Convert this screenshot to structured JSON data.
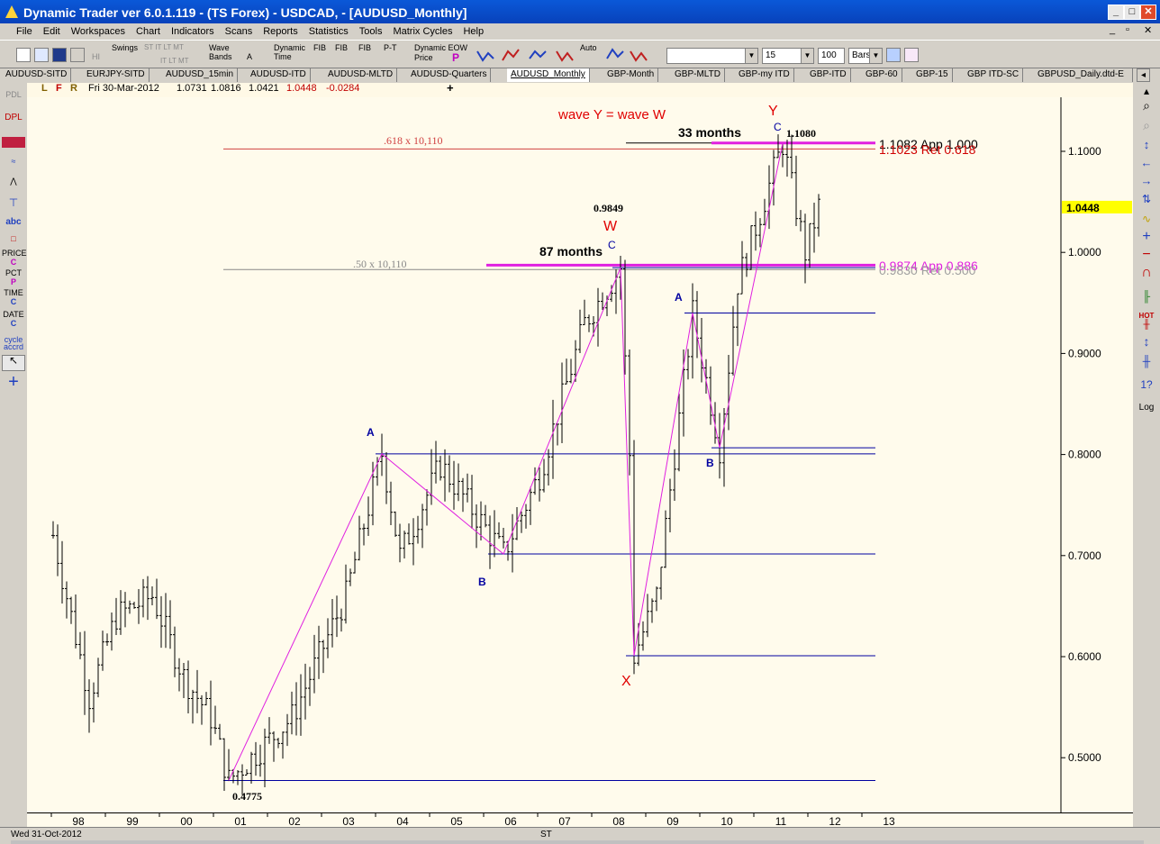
{
  "window": {
    "title": "Dynamic Trader ver 6.0.1.119 - (TS Forex) - USDCAD, - [AUDUSD_Monthly]",
    "controls": [
      "_",
      "□",
      "✕"
    ],
    "mdi_controls": [
      "_",
      "▫",
      "✕"
    ]
  },
  "menu": [
    "File",
    "Edit",
    "Workspaces",
    "Chart",
    "Indicators",
    "Scans",
    "Reports",
    "Statistics",
    "Tools",
    "Matrix Cycles",
    "Help"
  ],
  "toolbar": {
    "swings": "Swings",
    "swings_sub": "ST IT LT MT",
    "swings_sub2": "IT LT MT",
    "wave_bands": "Wave Bands",
    "wave_bands_a": "A",
    "dynamic_time": "Dynamic Time",
    "fib_t1": "FIB",
    "fib_t2": "FIB",
    "fib_t3": "FIB",
    "pt": "P-T",
    "dynamic_eow": "Dynamic EOW",
    "price": "Price",
    "p": "P",
    "auto": "Auto",
    "hi": "HI",
    "select1_value": "",
    "select2_value": "15",
    "count_value": "100",
    "bars_value": "Bars"
  },
  "tabs": [
    "AUDUSD-SITD",
    "EURJPY-SITD",
    "AUDUSD_15min",
    "AUDUSD-ITD",
    "AUDUSD-MLTD",
    "AUDUSD-Quarters",
    "AUDUSD_Monthly",
    "GBP-Month",
    "GBP-MLTD",
    "GBP-my ITD",
    "GBP-ITD",
    "GBP-60",
    "GBP-15",
    "GBP ITD-SC",
    "GBPUSD_Daily.dtd-E"
  ],
  "active_tab": "AUDUSD_Monthly",
  "infobar": {
    "l": "L",
    "f": "F",
    "r": "R",
    "date": "Fri 30-Mar-2012",
    "open": "1.0731",
    "high": "1.0816",
    "low": "1.0421",
    "close": "1.0448",
    "change": "-0.0284",
    "plus": "+"
  },
  "leftbar": {
    "pdl": "PDL",
    "dpl": "DPL",
    "abc": "abc",
    "price": "PRICE",
    "pct": "PCT",
    "time": "TIME",
    "date": "DATE",
    "cycle": "cycle",
    "accrd": "accrd",
    "c": "C",
    "p": "P"
  },
  "rightbar": {
    "hot": "HOT",
    "log": "Log",
    "q": "1?"
  },
  "status": {
    "date": "Wed 31-Oct-2012",
    "st": "ST"
  },
  "colors": {
    "magenta": "#e020e0",
    "blue": "#0000a0",
    "red": "#e00000",
    "price_tag": "#ffff00"
  },
  "chart_data": {
    "type": "ohlc-bar",
    "symbol": "AUDUSD",
    "timeframe": "Monthly",
    "x_tick_labels": [
      "98",
      "99",
      "00",
      "01",
      "02",
      "03",
      "04",
      "05",
      "06",
      "07",
      "08",
      "09",
      "10",
      "11",
      "12",
      "13"
    ],
    "y_tick_labels": [
      "1.1000",
      "1.0000",
      "0.9000",
      "0.8000",
      "0.7000",
      "0.6000",
      "0.5000"
    ],
    "ylim": [
      0.45,
      1.15
    ],
    "last_price_tag": "1.0448",
    "annotations": {
      "wave_y_eq_w": "wave Y = wave W",
      "fib_618": ".618 x 10,110",
      "fib_50": ".50 x 10,110",
      "months_33": "33 months",
      "months_87": "87 months",
      "high_1": "1.1080",
      "high_w": "0.9849",
      "low_0": "0.4775",
      "label_w": "W",
      "label_x": "X",
      "label_y": "Y",
      "label_c": "C",
      "label_a": "A",
      "label_b": "B",
      "app_1": "1.1082 App 1.000",
      "ret_618": "1.1023 Ret 0.618",
      "app_886": "0.9874 App 0.886",
      "ret_500": "0.9830 Ret 0.500"
    },
    "swings": [
      {
        "date": "2001-04",
        "price": 0.4775
      },
      {
        "date": "2004-02",
        "price": 0.8007
      },
      {
        "date": "2006-05",
        "price": 0.7016
      },
      {
        "date": "2008-07",
        "price": 0.9849
      },
      {
        "date": "2008-10",
        "price": 0.6009
      },
      {
        "date": "2009-11",
        "price": 0.94
      },
      {
        "date": "2010-05",
        "price": 0.8067
      },
      {
        "date": "2011-07",
        "price": 1.108
      }
    ]
  }
}
